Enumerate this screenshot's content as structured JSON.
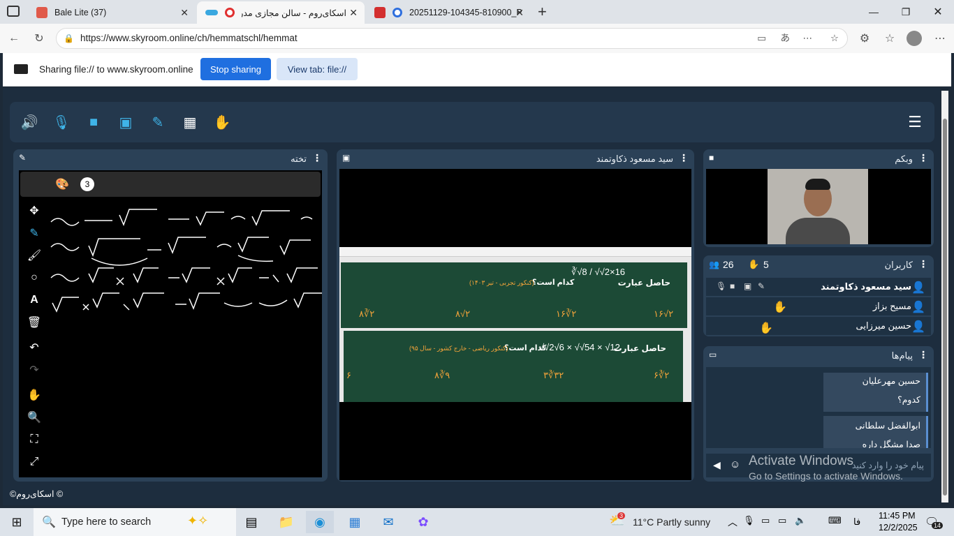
{
  "browser": {
    "tabs": [
      {
        "title": "Bale Lite (37)",
        "favicon_color": "#e05a4a"
      },
      {
        "title": "اسکای‌روم - سالن مجازی مدرسه",
        "favicon_color": "#e03030"
      },
      {
        "title": "20251129-104345-810900_P",
        "favicon_color": "#d32f2f"
      }
    ],
    "url": "https://www.skyroom.online/ch/hemmatschl/hemmat"
  },
  "share_bar": {
    "text": "Sharing file:// to www.skyroom.online",
    "stop_label": "Stop sharing",
    "view_label": "View tab: file://"
  },
  "panels": {
    "board": {
      "title": "تخته",
      "page_number": "3"
    },
    "screen": {
      "title": "سید مسعود ذکاوتمند"
    },
    "webcam": {
      "title": "وبکم"
    },
    "users": {
      "title": "کاربران",
      "count": "26",
      "hands": "5",
      "list": [
        "سید مسعود ذکاوتمند",
        "مسیح بزاز",
        "حسین میرزایی"
      ]
    },
    "messages": {
      "title": "پیام‌ها",
      "items": [
        {
          "name": "حسین مهرعلیان",
          "text": "کدوم؟"
        },
        {
          "name": "ابوالفضل سلطانی",
          "text": "صدا مشگل داره"
        }
      ],
      "placeholder": "پیام خود را وارد کنید"
    }
  },
  "shared_doc": {
    "q1_label": "حاصل عبارت",
    "q1_ask": "کدام است؟",
    "q1_src": "(کنکور تجربی - تیر ۱۴۰۳)",
    "q1_options": [
      "۸∛۲",
      "۸√۲",
      "۱۶∛۲",
      "۱۶√۲"
    ],
    "q2_label": "حاصل عبارت",
    "q2_ask": "کدام است؟",
    "q2_src": "(کنکور ریاضی - خارج کشور - سال ۹۵)",
    "q2_options": [
      "۶",
      "۸∛۹",
      "۳∛۳۲",
      "۶∛۲"
    ]
  },
  "footer": "©اسکای‌روم ©",
  "watermark": {
    "line1": "Activate Windows",
    "line2": "Go to Settings to activate Windows."
  },
  "taskbar": {
    "search": "Type here to search",
    "weather": "11°C  Partly sunny",
    "lang": "فا",
    "time": "11:45 PM",
    "date": "12/2/2025",
    "notif": "14",
    "weather_badge": "3"
  }
}
